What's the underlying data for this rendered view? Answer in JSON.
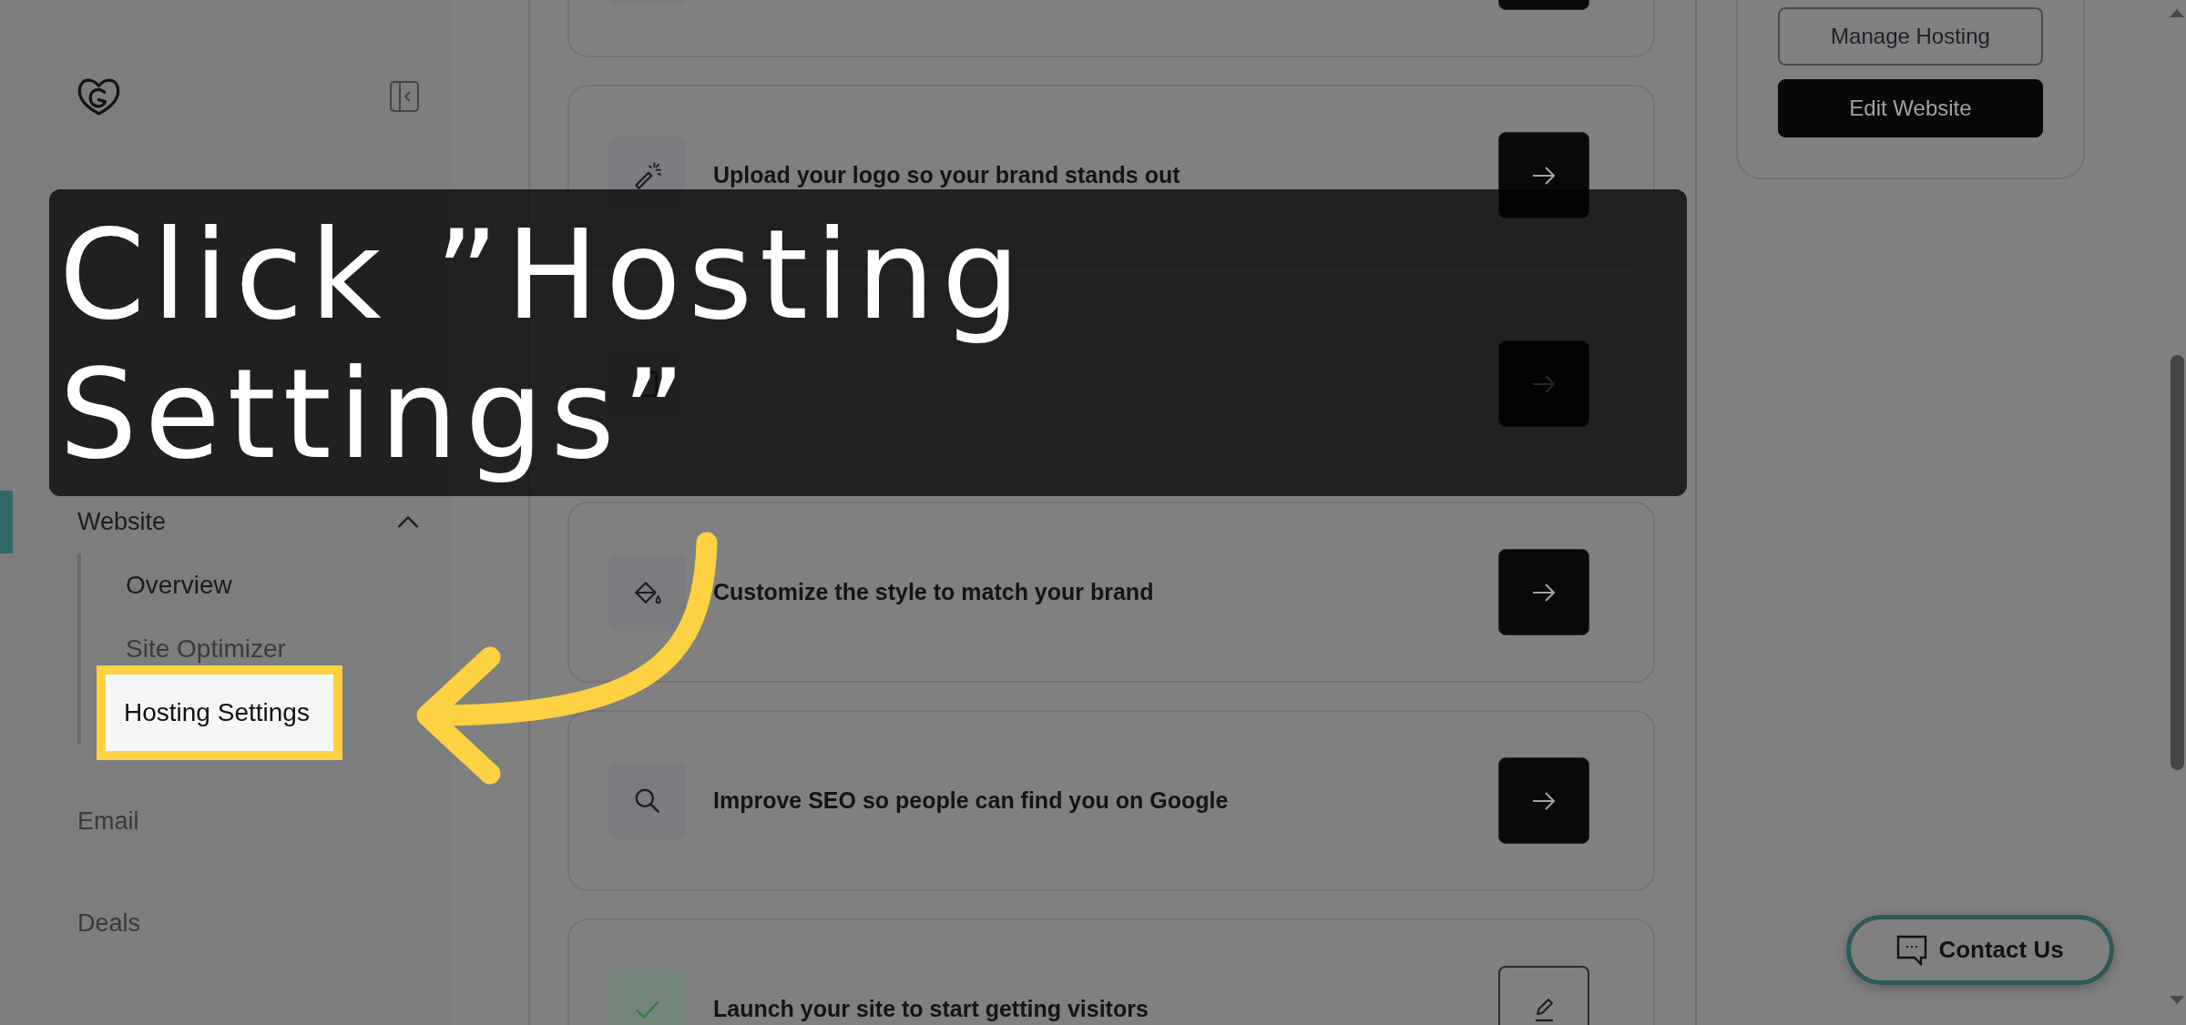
{
  "sidebar": {
    "nav": [
      {
        "label": "Website",
        "selected": true,
        "expanded": true,
        "children": [
          {
            "label": "Overview",
            "selected": true,
            "highlighted": false
          },
          {
            "label": "Site Optimizer",
            "selected": false,
            "highlighted": false
          },
          {
            "label": "Hosting Settings",
            "selected": false,
            "highlighted": true
          }
        ]
      },
      {
        "label": "Email",
        "selected": false
      },
      {
        "label": "Deals",
        "selected": false
      }
    ]
  },
  "tasks": [
    {
      "completed": false
    },
    {
      "title": "Upload your logo so your brand stands out",
      "completed": false
    },
    {
      "completed": false
    },
    {
      "title": "Customize the style to match your brand",
      "completed": false
    },
    {
      "title": "Improve SEO so people can find you on Google",
      "completed": false
    },
    {
      "title": "Launch your site to start getting visitors",
      "completed": true
    }
  ],
  "site_actions": [
    {
      "label": "Manage Hosting",
      "kind": "outline"
    },
    {
      "label": "Edit Website",
      "kind": "primary"
    }
  ],
  "contact_button": {
    "label": "Contact Us"
  },
  "tutorial": {
    "instruction": "Click ”Hosting Settings”"
  }
}
